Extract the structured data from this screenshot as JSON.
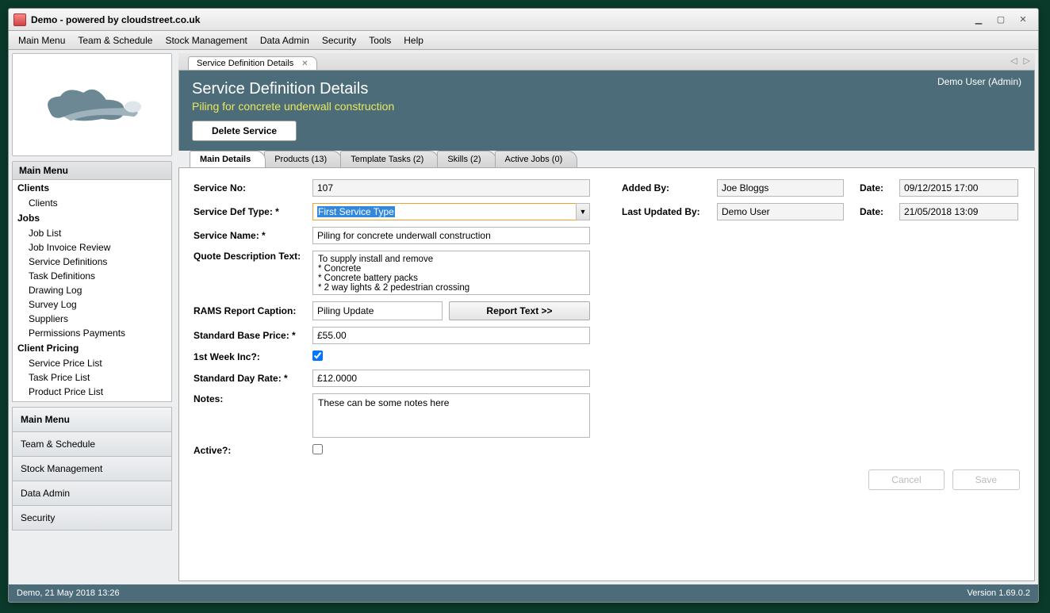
{
  "window": {
    "title": "Demo - powered by cloudstreet.co.uk"
  },
  "menubar": [
    "Main Menu",
    "Team & Schedule",
    "Stock Management",
    "Data Admin",
    "Security",
    "Tools",
    "Help"
  ],
  "sidebar": {
    "header": "Main Menu",
    "tree": [
      {
        "type": "group",
        "label": "Clients"
      },
      {
        "type": "item",
        "label": "Clients"
      },
      {
        "type": "group",
        "label": "Jobs"
      },
      {
        "type": "item",
        "label": "Job List"
      },
      {
        "type": "item",
        "label": "Job Invoice Review"
      },
      {
        "type": "item",
        "label": "Service Definitions"
      },
      {
        "type": "item",
        "label": "Task Definitions"
      },
      {
        "type": "item",
        "label": "Drawing Log"
      },
      {
        "type": "item",
        "label": "Survey Log"
      },
      {
        "type": "item",
        "label": "Suppliers"
      },
      {
        "type": "item",
        "label": "Permissions Payments"
      },
      {
        "type": "group",
        "label": "Client Pricing"
      },
      {
        "type": "item",
        "label": "Service Price List"
      },
      {
        "type": "item",
        "label": "Task Price List"
      },
      {
        "type": "item",
        "label": "Product Price List"
      }
    ],
    "bottom_nav": [
      "Main Menu",
      "Team & Schedule",
      "Stock Management",
      "Data Admin",
      "Security"
    ]
  },
  "doc_tab": {
    "label": "Service Definition Details"
  },
  "page_header": {
    "title": "Service Definition Details",
    "subtitle": "Piling for concrete underwall construction",
    "user": "Demo User (Admin)",
    "delete_btn": "Delete Service"
  },
  "inner_tabs": [
    "Main Details",
    "Products (13)",
    "Template Tasks (2)",
    "Skills (2)",
    "Active Jobs (0)"
  ],
  "form": {
    "service_no_lbl": "Service No:",
    "service_no": "107",
    "added_by_lbl": "Added By:",
    "added_by": "Joe Bloggs",
    "added_date_lbl": "Date:",
    "added_date": "09/12/2015 17:00",
    "def_type_lbl": "Service Def Type: *",
    "def_type": "First Service Type",
    "updated_by_lbl": "Last Updated By:",
    "updated_by": "Demo User",
    "updated_date_lbl": "Date:",
    "updated_date": "21/05/2018 13:09",
    "service_name_lbl": "Service Name: *",
    "service_name": "Piling for concrete underwall construction",
    "quote_lbl": "Quote Description Text:",
    "quote_text": "To supply install and remove\n* Concrete\n* Concrete battery packs\n* 2 way lights & 2 pedestrian crossing",
    "rams_lbl": "RAMS Report Caption:",
    "rams_caption": "Piling Update",
    "rams_btn": "Report Text >>",
    "base_price_lbl": "Standard Base Price: *",
    "base_price": "£55.00",
    "first_week_lbl": "1st Week Inc?:",
    "first_week": true,
    "day_rate_lbl": "Standard Day Rate: *",
    "day_rate": "£12.0000",
    "notes_lbl": "Notes:",
    "notes": "These can be some notes here",
    "active_lbl": "Active?:",
    "active": false,
    "cancel_btn": "Cancel",
    "save_btn": "Save"
  },
  "statusbar": {
    "left": "Demo, 21 May 2018 13:26",
    "right": "Version 1.69.0.2"
  }
}
